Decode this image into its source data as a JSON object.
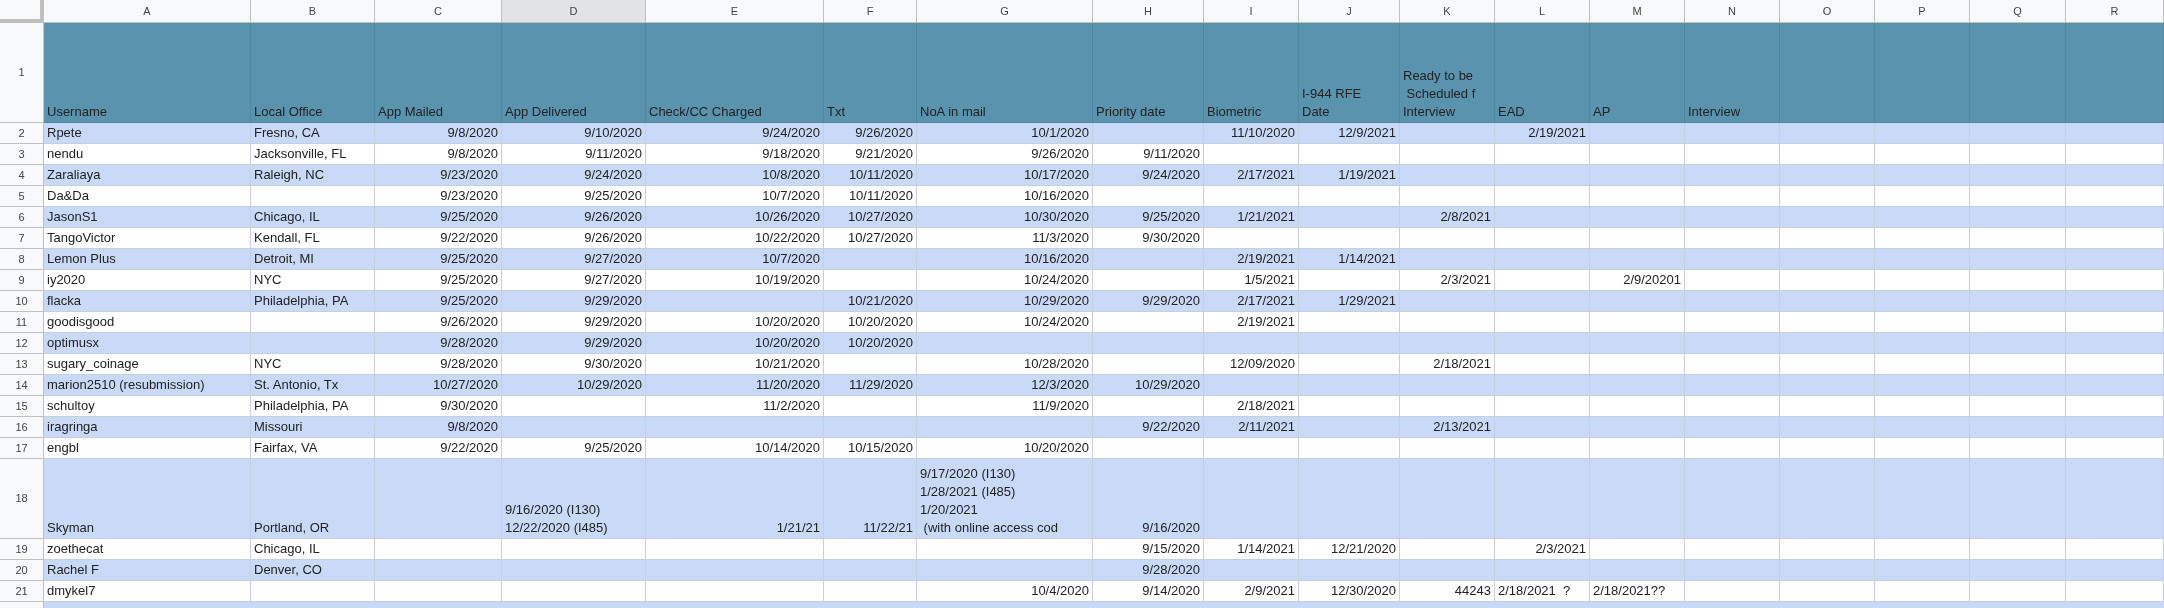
{
  "columns": [
    {
      "letter": "A",
      "selected": false,
      "kind": "text"
    },
    {
      "letter": "B",
      "selected": false,
      "kind": "text"
    },
    {
      "letter": "C",
      "selected": false,
      "kind": "number"
    },
    {
      "letter": "D",
      "selected": true,
      "kind": "number"
    },
    {
      "letter": "E",
      "selected": false,
      "kind": "number"
    },
    {
      "letter": "F",
      "selected": false,
      "kind": "number"
    },
    {
      "letter": "G",
      "selected": false,
      "kind": "number"
    },
    {
      "letter": "H",
      "selected": false,
      "kind": "number"
    },
    {
      "letter": "I",
      "selected": false,
      "kind": "number"
    },
    {
      "letter": "J",
      "selected": false,
      "kind": "number"
    },
    {
      "letter": "K",
      "selected": false,
      "kind": "number"
    },
    {
      "letter": "L",
      "selected": false,
      "kind": "number"
    },
    {
      "letter": "M",
      "selected": false,
      "kind": "number"
    },
    {
      "letter": "N",
      "selected": false,
      "kind": "number"
    },
    {
      "letter": "O",
      "selected": false,
      "kind": "number"
    },
    {
      "letter": "P",
      "selected": false,
      "kind": "number"
    },
    {
      "letter": "Q",
      "selected": false,
      "kind": "number"
    },
    {
      "letter": "R",
      "selected": false,
      "kind": "number"
    }
  ],
  "rows": [
    {
      "number": "1",
      "kind": "header",
      "cells": {
        "A": "Username",
        "B": "Local Office",
        "C": "App Mailed",
        "D": "App Delivered",
        "E": "Check/CC Charged",
        "F": "Txt",
        "G": "NoA in mail",
        "H": "Priority date",
        "I": "Biometric",
        "J": {
          "lines": [
            "I-944 RFE",
            "Date"
          ]
        },
        "K": {
          "lines": [
            "Ready to be",
            " Scheduled f",
            "Interview"
          ]
        },
        "L": "EAD",
        "M": "AP",
        "N": "Interview"
      }
    },
    {
      "number": "2",
      "kind": "data",
      "banded": true,
      "cells": {
        "A": "Rpete",
        "B": "Fresno, CA",
        "C": "9/8/2020",
        "D": "9/10/2020",
        "E": "9/24/2020",
        "F": "9/26/2020",
        "G": "10/1/2020",
        "I": "11/10/2020",
        "J": "12/9/2021",
        "L": "2/19/2021"
      }
    },
    {
      "number": "3",
      "kind": "data",
      "banded": false,
      "cells": {
        "A": "nendu",
        "B": "Jacksonville, FL",
        "C": "9/8/2020",
        "D": "9/11/2020",
        "E": "9/18/2020",
        "F": "9/21/2020",
        "G": "9/26/2020",
        "H": "9/11/2020"
      }
    },
    {
      "number": "4",
      "kind": "data",
      "banded": true,
      "cells": {
        "A": "Zaraliaya",
        "B": "Raleigh, NC",
        "C": "9/23/2020",
        "D": "9/24/2020",
        "E": "10/8/2020",
        "F": "10/11/2020",
        "G": "10/17/2020",
        "H": "9/24/2020",
        "I": "2/17/2021",
        "J": "1/19/2021"
      }
    },
    {
      "number": "5",
      "kind": "data",
      "banded": false,
      "cells": {
        "A": "Da&Da",
        "C": "9/23/2020",
        "D": "9/25/2020",
        "E": "10/7/2020",
        "F": "10/11/2020",
        "G": "10/16/2020"
      }
    },
    {
      "number": "6",
      "kind": "data",
      "banded": true,
      "cells": {
        "A": "JasonS1",
        "B": "Chicago, IL",
        "C": "9/25/2020",
        "D": "9/26/2020",
        "E": "10/26/2020",
        "F": "10/27/2020",
        "G": "10/30/2020",
        "H": "9/25/2020",
        "I": "1/21/2021",
        "K": "2/8/2021"
      }
    },
    {
      "number": "7",
      "kind": "data",
      "banded": false,
      "cells": {
        "A": "TangoVictor",
        "B": "Kendall, FL",
        "C": "9/22/2020",
        "D": "9/26/2020",
        "E": "10/22/2020",
        "F": "10/27/2020",
        "G": "11/3/2020",
        "H": "9/30/2020"
      }
    },
    {
      "number": "8",
      "kind": "data",
      "banded": true,
      "cells": {
        "A": "Lemon Plus",
        "B": "Detroit, MI",
        "C": "9/25/2020",
        "D": "9/27/2020",
        "E": "10/7/2020",
        "G": "10/16/2020",
        "I": "2/19/2021",
        "J": "1/14/2021"
      }
    },
    {
      "number": "9",
      "kind": "data",
      "banded": false,
      "cells": {
        "A": "iy2020",
        "B": "NYC",
        "C": "9/25/2020",
        "D": "9/27/2020",
        "E": "10/19/2020",
        "G": "10/24/2020",
        "I": "1/5/2021",
        "K": "2/3/2021",
        "M": "2/9/20201"
      }
    },
    {
      "number": "10",
      "kind": "data",
      "banded": true,
      "cells": {
        "A": "flacka",
        "B": "Philadelphia, PA",
        "C": "9/25/2020",
        "D": "9/29/2020",
        "F": "10/21/2020",
        "G": "10/29/2020",
        "H": "9/29/2020",
        "I": "2/17/2021",
        "J": "1/29/2021"
      }
    },
    {
      "number": "11",
      "kind": "data",
      "banded": false,
      "cells": {
        "A": "goodisgood",
        "C": "9/26/2020",
        "D": "9/29/2020",
        "E": "10/20/2020",
        "F": "10/20/2020",
        "G": "10/24/2020",
        "I": "2/19/2021"
      }
    },
    {
      "number": "12",
      "kind": "data",
      "banded": true,
      "cells": {
        "A": "optimusx",
        "C": "9/28/2020",
        "D": "9/29/2020",
        "E": "10/20/2020",
        "F": "10/20/2020"
      }
    },
    {
      "number": "13",
      "kind": "data",
      "banded": false,
      "cells": {
        "A": "sugary_coinage",
        "B": "NYC",
        "C": "9/28/2020",
        "D": "9/30/2020",
        "E": "10/21/2020",
        "G": "10/28/2020",
        "I": "12/09/2020",
        "K": "2/18/2021"
      }
    },
    {
      "number": "14",
      "kind": "data",
      "banded": true,
      "cells": {
        "A": "marion2510 (resubmission)",
        "B": "St. Antonio, Tx",
        "C": "10/27/2020",
        "D": "10/29/2020",
        "E": "11/20/2020",
        "F": "11/29/2020",
        "G": "12/3/2020",
        "H": "10/29/2020"
      }
    },
    {
      "number": "15",
      "kind": "data",
      "banded": false,
      "cells": {
        "A": "schultoy",
        "B": "Philadelphia, PA",
        "C": "9/30/2020",
        "E": "11/2/2020",
        "G": "11/9/2020",
        "I": "2/18/2021"
      }
    },
    {
      "number": "16",
      "kind": "data",
      "banded": true,
      "cells": {
        "A": "iragringa",
        "B": "Missouri",
        "C": "9/8/2020",
        "H": "9/22/2020",
        "I": "2/11/2021",
        "K": "2/13/2021"
      }
    },
    {
      "number": "17",
      "kind": "data",
      "banded": false,
      "cells": {
        "A": "engbl",
        "B": "Fairfax, VA",
        "C": "9/22/2020",
        "D": "9/25/2020",
        "E": "10/14/2020",
        "F": "10/15/2020",
        "G": "10/20/2020"
      }
    },
    {
      "number": "18",
      "kind": "tall",
      "banded": true,
      "cells": {
        "A": "Skyman",
        "B": "Portland, OR",
        "D": {
          "kind": "text",
          "lines": [
            "9/16/2020 (I130)",
            "12/22/2020 (I485)"
          ]
        },
        "E": "1/21/21",
        "F": "11/22/21",
        "G": {
          "kind": "text",
          "lines": [
            "9/17/2020 (I130)",
            "1/28/2021 (I485)",
            "1/20/2021",
            " (with online access cod"
          ]
        },
        "H": "9/16/2020"
      }
    },
    {
      "number": "19",
      "kind": "data",
      "banded": false,
      "cells": {
        "A": "zoethecat",
        "B": "Chicago, IL",
        "H": "9/15/2020",
        "I": "1/14/2021",
        "J": "12/21/2020",
        "L": "2/3/2021"
      }
    },
    {
      "number": "20",
      "kind": "data",
      "banded": true,
      "cells": {
        "A": "Rachel F",
        "B": "Denver, CO",
        "H": "9/28/2020"
      }
    },
    {
      "number": "21",
      "kind": "data",
      "banded": false,
      "cells": {
        "A": "dmykel7",
        "G": "10/4/2020",
        "H": "9/14/2020",
        "I": "2/9/2021",
        "J": "12/30/2020",
        "K": "44243",
        "L": {
          "kind": "text",
          "lines": [
            "2/18/2021  ?"
          ]
        },
        "M": {
          "kind": "text",
          "lines": [
            "2/18/2021??"
          ]
        }
      }
    }
  ]
}
